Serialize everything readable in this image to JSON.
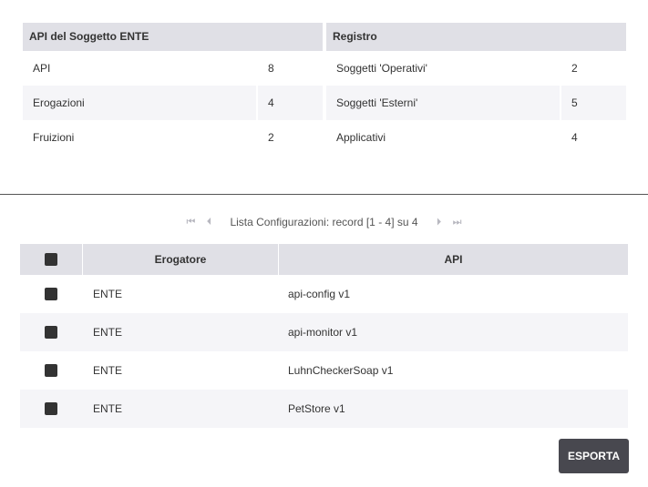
{
  "api_summary": {
    "title": "API del Soggetto ENTE",
    "rows": [
      {
        "label": "API",
        "value": "8"
      },
      {
        "label": "Erogazioni",
        "value": "4"
      },
      {
        "label": "Fruizioni",
        "value": "2"
      }
    ]
  },
  "registry_summary": {
    "title": "Registro",
    "rows": [
      {
        "label": "Soggetti 'Operativi'",
        "value": "2"
      },
      {
        "label": "Soggetti 'Esterni'",
        "value": "5"
      },
      {
        "label": "Applicativi",
        "value": "4"
      }
    ]
  },
  "pager": {
    "first_icon": "first-page-icon",
    "prev_icon": "prev-page-icon",
    "info": "Lista Configurazioni: record [1 - 4] su 4",
    "next_icon": "next-page-icon",
    "last_icon": "last-page-icon"
  },
  "table": {
    "headers": {
      "erogatore": "Erogatore",
      "api": "API"
    },
    "rows": [
      {
        "erogatore": "ENTE",
        "api": "api-config v1"
      },
      {
        "erogatore": "ENTE",
        "api": "api-monitor v1"
      },
      {
        "erogatore": "ENTE",
        "api": "LuhnCheckerSoap v1"
      },
      {
        "erogatore": "ENTE",
        "api": "PetStore v1"
      }
    ]
  },
  "actions": {
    "export_label": "ESPORTA"
  },
  "colors": {
    "header_bg": "#e0e0e6",
    "alt_row_bg": "#f5f5f8",
    "button_bg": "#48484f"
  }
}
